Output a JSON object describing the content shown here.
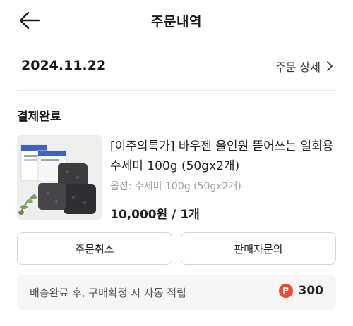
{
  "header": {
    "title": "주문내역",
    "back_icon": "arrow-left-icon"
  },
  "order": {
    "date": "2024.11.22",
    "detail_link_label": "주문 상세",
    "detail_icon": "chevron-right-icon",
    "status": "결제완료"
  },
  "product": {
    "name": "[이주의특가] 바우젠 올인원 뜯어쓰는 일회용 수세미 100g (50gx2개)",
    "option": "옵션: 수세미 100g (50gx2개)",
    "price": "10,000원 / 1개"
  },
  "actions": {
    "cancel_label": "주문취소",
    "inquiry_label": "판매자문의"
  },
  "points": {
    "notice": "배송완료 후, 구매확정 시 자동 적립",
    "badge": "P",
    "value": "300",
    "badge_color": "#f24a2c"
  }
}
